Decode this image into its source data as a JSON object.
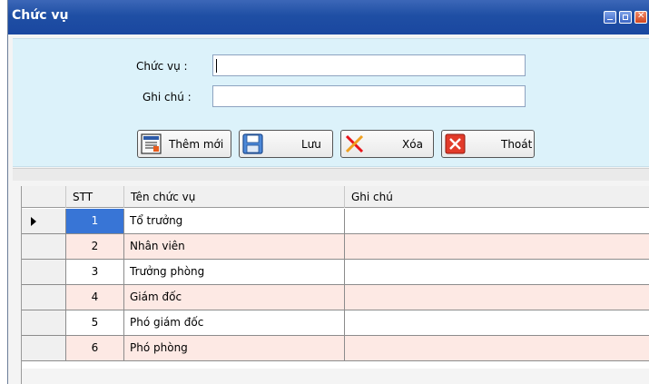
{
  "window": {
    "title": "Chức vụ"
  },
  "form": {
    "position_label": "Chức vụ :",
    "position_value": "",
    "note_label": "Ghi chú :",
    "note_value": ""
  },
  "buttons": {
    "add_label": "Thêm mới",
    "save_label": "Lưu",
    "delete_label": "Xóa",
    "exit_label": "Thoát"
  },
  "table": {
    "columns": [
      "STT",
      "Tên chức vụ",
      "Ghi chú"
    ],
    "rows": [
      {
        "stt": "1",
        "name": "Tổ trưởng",
        "note": ""
      },
      {
        "stt": "2",
        "name": "Nhân viên",
        "note": ""
      },
      {
        "stt": "3",
        "name": "Trưởng phòng",
        "note": ""
      },
      {
        "stt": "4",
        "name": "Giám đốc",
        "note": ""
      },
      {
        "stt": "5",
        "name": "Phó giám đốc",
        "note": ""
      },
      {
        "stt": "6",
        "name": "Phó phòng",
        "note": ""
      }
    ],
    "selected_row": 1
  },
  "colors": {
    "titlebar": "#1f4fa4",
    "form_bg": "#dcf2fa",
    "row_alt": "#fde9e4",
    "selection": "#3875d6"
  }
}
